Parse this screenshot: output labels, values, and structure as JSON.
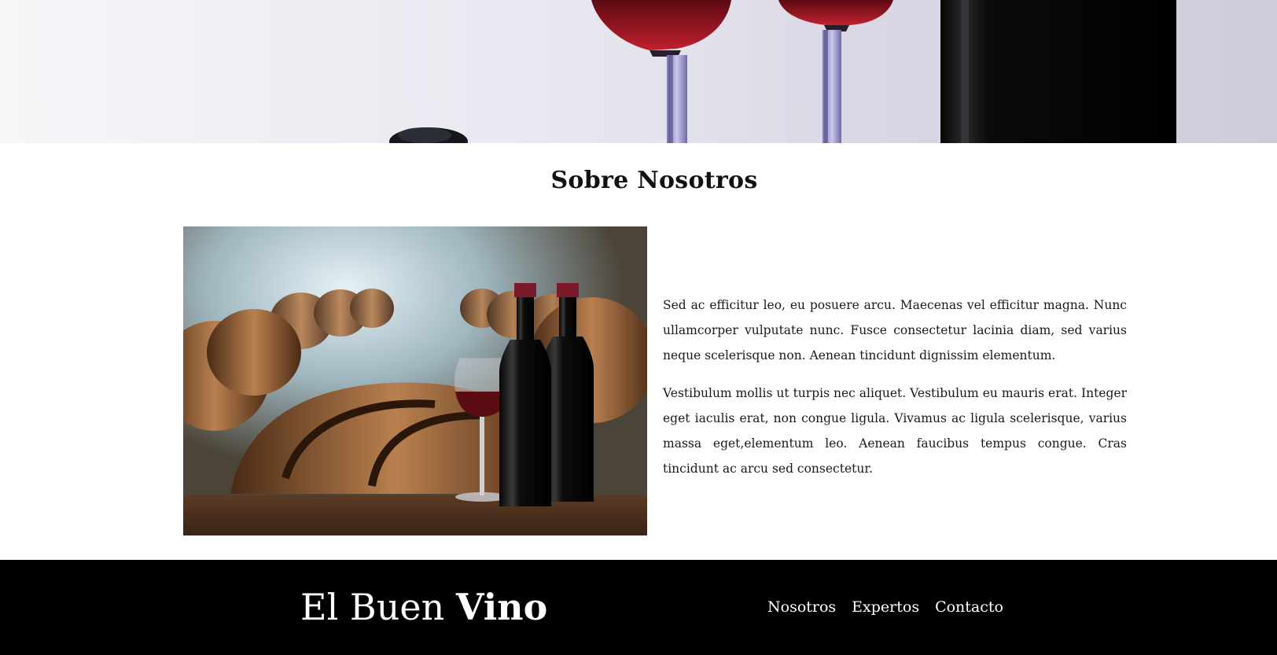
{
  "hero": {
    "image": "wine-glasses-and-bottle-photo"
  },
  "about": {
    "title": "Sobre Nosotros",
    "image": "wine-cellar-barrels-photo",
    "paragraphs": [
      "Sed ac efficitur leo, eu posuere arcu. Maecenas vel efficitur magna. Nunc ullamcorper vulputate nunc. Fusce consectetur lacinia diam, sed varius neque scelerisque non. Aenean tincidunt dignissim elementum.",
      "Vestibulum mollis ut turpis nec aliquet. Vestibulum eu mauris erat. Integer eget iaculis erat, non congue ligula. Vivamus ac ligula scelerisque, varius massa eget,elementum leo. Aenean faucibus tempus congue. Cras tincidunt ac arcu sed consectetur."
    ]
  },
  "footer": {
    "logo_light": "El Buen",
    "logo_bold": "Vino",
    "nav": [
      "Nosotros",
      "Expertos",
      "Contacto"
    ]
  },
  "colors": {
    "footer_bg": "#000000",
    "text": "#111111",
    "wine": "#7a0d16"
  }
}
